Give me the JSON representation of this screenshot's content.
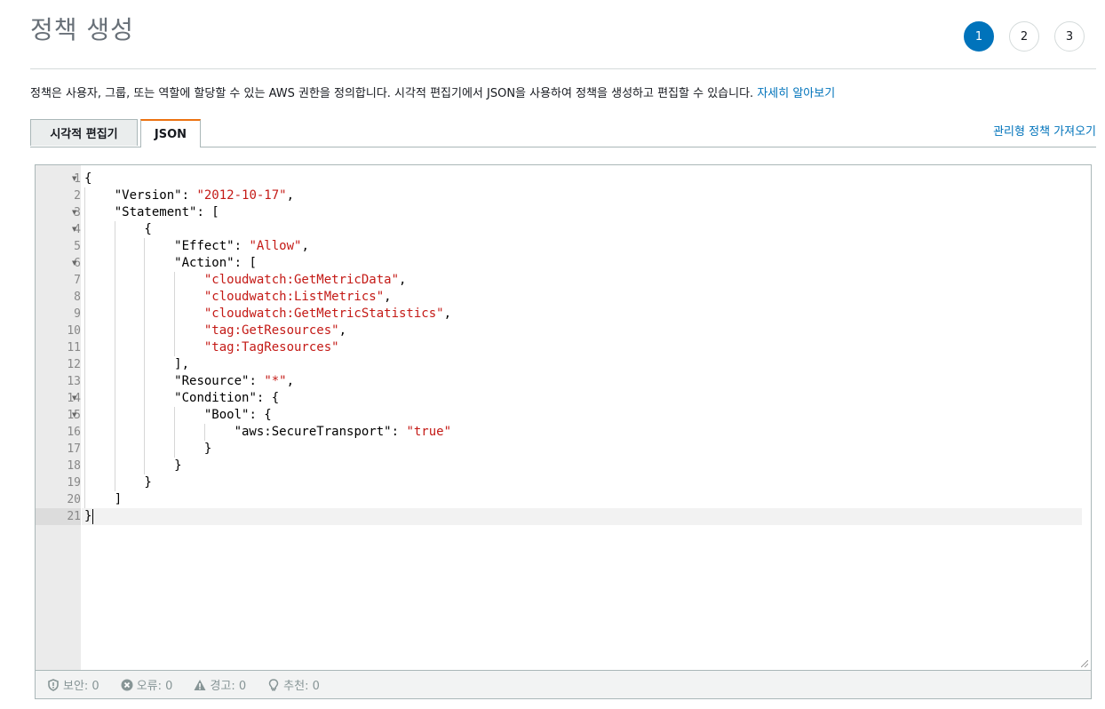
{
  "header": {
    "title": "정책 생성",
    "steps": [
      "1",
      "2",
      "3"
    ],
    "active_step": "1"
  },
  "description": {
    "text": "정책은 사용자, 그룹, 또는 역할에 할당할 수 있는 AWS 권한을 정의합니다. 시각적 편집기에서 JSON을 사용하여 정책을 생성하고 편집할 수 있습니다. ",
    "link": "자세히 알아보기"
  },
  "tabs": {
    "visual": "시각적 편집기",
    "json": "JSON",
    "active": "JSON"
  },
  "import_link": "관리형 정책 가져오기",
  "editor": {
    "current_line": 21,
    "foldable_lines": [
      1,
      3,
      4,
      6,
      14,
      15
    ],
    "lines": [
      [
        {
          "t": "p",
          "v": "{"
        }
      ],
      [
        {
          "t": "p",
          "v": "    "
        },
        {
          "t": "k",
          "v": "\"Version\""
        },
        {
          "t": "p",
          "v": ": "
        },
        {
          "t": "s",
          "v": "\"2012-10-17\""
        },
        {
          "t": "p",
          "v": ","
        }
      ],
      [
        {
          "t": "p",
          "v": "    "
        },
        {
          "t": "k",
          "v": "\"Statement\""
        },
        {
          "t": "p",
          "v": ": ["
        }
      ],
      [
        {
          "t": "p",
          "v": "        {"
        }
      ],
      [
        {
          "t": "p",
          "v": "            "
        },
        {
          "t": "k",
          "v": "\"Effect\""
        },
        {
          "t": "p",
          "v": ": "
        },
        {
          "t": "s",
          "v": "\"Allow\""
        },
        {
          "t": "p",
          "v": ","
        }
      ],
      [
        {
          "t": "p",
          "v": "            "
        },
        {
          "t": "k",
          "v": "\"Action\""
        },
        {
          "t": "p",
          "v": ": ["
        }
      ],
      [
        {
          "t": "p",
          "v": "                "
        },
        {
          "t": "s",
          "v": "\"cloudwatch:GetMetricData\""
        },
        {
          "t": "p",
          "v": ","
        }
      ],
      [
        {
          "t": "p",
          "v": "                "
        },
        {
          "t": "s",
          "v": "\"cloudwatch:ListMetrics\""
        },
        {
          "t": "p",
          "v": ","
        }
      ],
      [
        {
          "t": "p",
          "v": "                "
        },
        {
          "t": "s",
          "v": "\"cloudwatch:GetMetricStatistics\""
        },
        {
          "t": "p",
          "v": ","
        }
      ],
      [
        {
          "t": "p",
          "v": "                "
        },
        {
          "t": "s",
          "v": "\"tag:GetResources\""
        },
        {
          "t": "p",
          "v": ","
        }
      ],
      [
        {
          "t": "p",
          "v": "                "
        },
        {
          "t": "s",
          "v": "\"tag:TagResources\""
        }
      ],
      [
        {
          "t": "p",
          "v": "            ],"
        }
      ],
      [
        {
          "t": "p",
          "v": "            "
        },
        {
          "t": "k",
          "v": "\"Resource\""
        },
        {
          "t": "p",
          "v": ": "
        },
        {
          "t": "s",
          "v": "\"*\""
        },
        {
          "t": "p",
          "v": ","
        }
      ],
      [
        {
          "t": "p",
          "v": "            "
        },
        {
          "t": "k",
          "v": "\"Condition\""
        },
        {
          "t": "p",
          "v": ": {"
        }
      ],
      [
        {
          "t": "p",
          "v": "                "
        },
        {
          "t": "k",
          "v": "\"Bool\""
        },
        {
          "t": "p",
          "v": ": {"
        }
      ],
      [
        {
          "t": "p",
          "v": "                    "
        },
        {
          "t": "k",
          "v": "\"aws:SecureTransport\""
        },
        {
          "t": "p",
          "v": ": "
        },
        {
          "t": "s",
          "v": "\"true\""
        }
      ],
      [
        {
          "t": "p",
          "v": "                }"
        }
      ],
      [
        {
          "t": "p",
          "v": "            }"
        }
      ],
      [
        {
          "t": "p",
          "v": "        }"
        }
      ],
      [
        {
          "t": "p",
          "v": "    ]"
        }
      ],
      [
        {
          "t": "p",
          "v": "}"
        }
      ]
    ]
  },
  "status": {
    "security": "보안: 0",
    "errors": "오류: 0",
    "warnings": "경고: 0",
    "suggestions": "추천: 0"
  }
}
